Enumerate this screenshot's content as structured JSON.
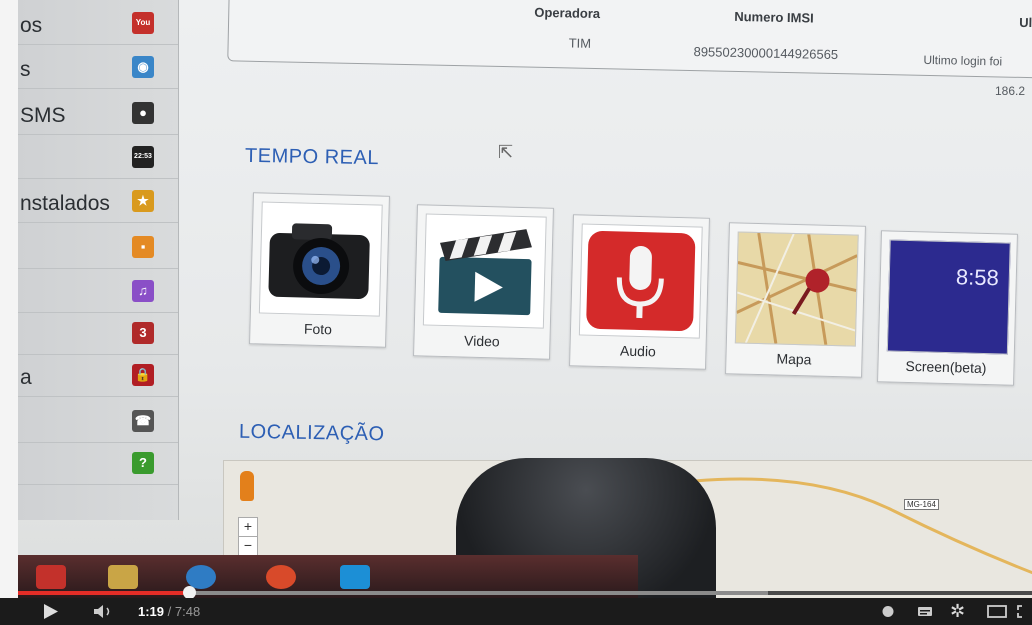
{
  "sidebar": {
    "items": [
      {
        "label": "os",
        "icon": "youtube-icon",
        "color": "#c4302b"
      },
      {
        "label": "s",
        "icon": "cube-icon",
        "color": "#3a86c8"
      },
      {
        "label": "SMS",
        "icon": "sms-icon",
        "color": "#333333"
      },
      {
        "label": "",
        "icon": "clock-icon",
        "color": "#222222"
      },
      {
        "label": "nstalados",
        "icon": "star-icon",
        "color": "#d99a1e"
      },
      {
        "label": "",
        "icon": "contacts-icon",
        "color": "#e48a24"
      },
      {
        "label": "",
        "icon": "music-icon",
        "color": "#8a4fc7"
      },
      {
        "label": "",
        "icon": "calendar-icon",
        "color": "#b02a2a"
      },
      {
        "label": "a",
        "icon": "lock-icon",
        "color": "#b11e24"
      },
      {
        "label": "",
        "icon": "phone-icon",
        "color": "#555555"
      },
      {
        "label": "",
        "icon": "help-icon",
        "color": "#3a9b2e"
      }
    ],
    "icon_glyphs": [
      "You",
      "◉",
      "●",
      "22:53",
      "★",
      "▪",
      "♫",
      "3",
      "🔒",
      "☎",
      "?"
    ]
  },
  "info": {
    "col_operadora": "Operadora",
    "col_imsi": "Numero IMSI",
    "col_ultimo": "Ulti",
    "operadora": "TIM",
    "imsi": "89550230000144926565",
    "ultimo_line1": "Ultimo login foi",
    "ultimo_line2": "186.2"
  },
  "tempo_real": {
    "title": "TEMPO REAL",
    "tiles": [
      {
        "label": "Foto",
        "icon": "camera-icon"
      },
      {
        "label": "Video",
        "icon": "clapperboard-icon"
      },
      {
        "label": "Audio",
        "icon": "microphone-icon"
      },
      {
        "label": "Mapa",
        "icon": "map-pin-icon"
      },
      {
        "label": "Screen(beta)",
        "icon": "phone-screen-icon",
        "clock": "8:58"
      }
    ]
  },
  "localizacao": {
    "title": "LOCALIZAÇÃO",
    "zoom_in": "+",
    "zoom_out": "−",
    "road": "MG-164"
  },
  "player": {
    "current_time": "1:19",
    "total_time": "/ 7:48",
    "played_fraction": 0.169,
    "buffered_fraction": 0.74,
    "accent": "#e52d27"
  }
}
